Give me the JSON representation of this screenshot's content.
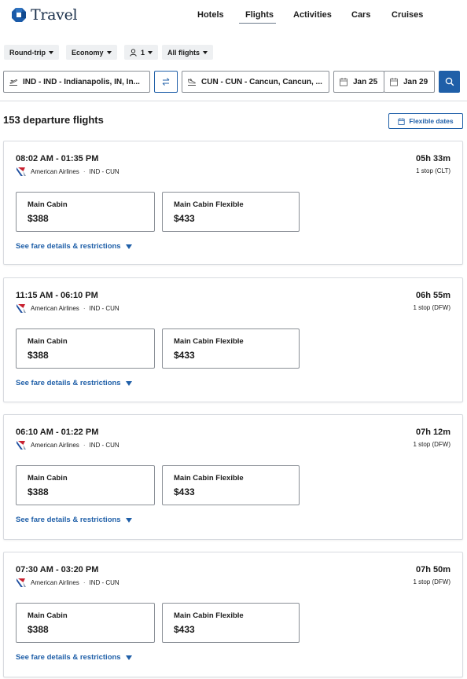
{
  "brand": {
    "name": "Travel"
  },
  "nav": [
    "Hotels",
    "Flights",
    "Activities",
    "Cars",
    "Cruises"
  ],
  "filters": {
    "trip_type": "Round-trip",
    "cabin": "Economy",
    "travelers": "1",
    "flight_type": "All flights"
  },
  "search": {
    "origin": "IND - IND - Indianapolis, IN, In...",
    "destination": "CUN - CUN - Cancun, Cancun, ...",
    "depart_date": "Jan 25",
    "return_date": "Jan 29"
  },
  "results": {
    "count_text": "153 departure flights",
    "flexible_dates_label": "Flexible dates"
  },
  "flights": [
    {
      "times": "08:02 AM - 01:35 PM",
      "airline": "American Airlines",
      "route": "IND - CUN",
      "duration": "05h 33m",
      "stops": "1 stop (CLT)",
      "fares": [
        {
          "name": "Main Cabin",
          "price": "$388"
        },
        {
          "name": "Main Cabin Flexible",
          "price": "$433"
        }
      ],
      "details_link": "See fare details & restrictions"
    },
    {
      "times": "11:15 AM - 06:10 PM",
      "airline": "American Airlines",
      "route": "IND - CUN",
      "duration": "06h 55m",
      "stops": "1 stop (DFW)",
      "fares": [
        {
          "name": "Main Cabin",
          "price": "$388"
        },
        {
          "name": "Main Cabin Flexible",
          "price": "$433"
        }
      ],
      "details_link": "See fare details & restrictions"
    },
    {
      "times": "06:10 AM - 01:22 PM",
      "airline": "American Airlines",
      "route": "IND - CUN",
      "duration": "07h 12m",
      "stops": "1 stop (DFW)",
      "fares": [
        {
          "name": "Main Cabin",
          "price": "$388"
        },
        {
          "name": "Main Cabin Flexible",
          "price": "$433"
        }
      ],
      "details_link": "See fare details & restrictions"
    },
    {
      "times": "07:30 AM - 03:20 PM",
      "airline": "American Airlines",
      "route": "IND - CUN",
      "duration": "07h 50m",
      "stops": "1 stop (DFW)",
      "fares": [
        {
          "name": "Main Cabin",
          "price": "$388"
        },
        {
          "name": "Main Cabin Flexible",
          "price": "$433"
        }
      ],
      "details_link": "See fare details & restrictions"
    }
  ],
  "colors": {
    "accent": "#1f5fa8",
    "brand_dark": "#1a2f4a",
    "border": "#8a8f96",
    "chip_bg": "#eef0f2"
  }
}
